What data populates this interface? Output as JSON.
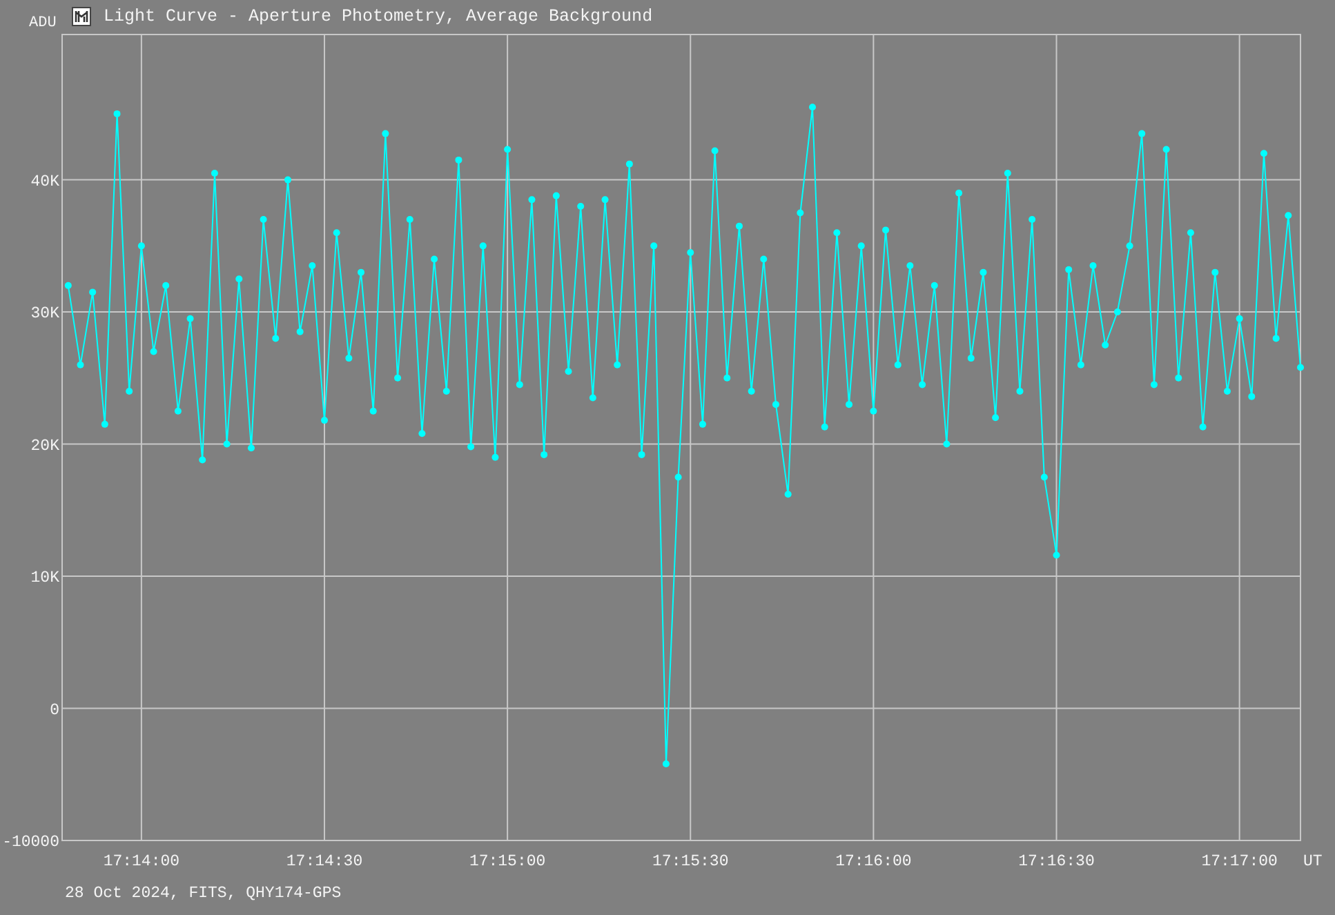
{
  "window": {
    "title": "Light Curve - Aperture Photometry, Average Background"
  },
  "chart": {
    "chart_data": {
      "type": "line",
      "ylabel": "ADU",
      "xlabel": "UT",
      "categories": [
        null,
        null,
        null,
        null,
        null,
        null,
        "17:14:00",
        null,
        null,
        null,
        null,
        null,
        null,
        null,
        null,
        null,
        null,
        null,
        null,
        null,
        null,
        "17:14:30",
        null,
        null,
        null,
        null,
        null,
        null,
        null,
        null,
        null,
        null,
        null,
        null,
        null,
        null,
        "17:15:00",
        null,
        null,
        null,
        null,
        null,
        null,
        null,
        null,
        null,
        null,
        null,
        null,
        null,
        null,
        "17:15:30",
        null,
        null,
        null,
        null,
        null,
        null,
        null,
        null,
        null,
        null,
        null,
        null,
        null,
        null,
        "17:16:00",
        null,
        null,
        null,
        null,
        null,
        null,
        null,
        null,
        null,
        null,
        null,
        null,
        null,
        null,
        "17:16:30",
        null,
        null,
        null,
        null,
        null,
        null,
        null,
        null,
        null,
        null,
        null,
        null,
        null,
        null,
        "17:17:00",
        null,
        null,
        null,
        null,
        null
      ],
      "grid": true,
      "series": [
        {
          "color": "#00ffff",
          "marker": "circle",
          "values": [
            32000,
            26000,
            31500,
            21500,
            45000,
            24000,
            35000,
            27000,
            32000,
            22500,
            29500,
            18800,
            40500,
            20000,
            32500,
            19700,
            37000,
            28000,
            40000,
            28500,
            33500,
            21800,
            36000,
            26500,
            33000,
            22500,
            43500,
            25000,
            37000,
            20800,
            34000,
            24000,
            41500,
            19800,
            35000,
            19000,
            42300,
            24500,
            38500,
            19200,
            38800,
            25500,
            38000,
            23500,
            38500,
            26000,
            41200,
            19200,
            35000,
            -4200,
            17500,
            34500,
            21500,
            42200,
            25000,
            36500,
            24000,
            34000,
            23000,
            16200,
            37500,
            45500,
            21300,
            36000,
            23000,
            35000,
            22500,
            36200,
            26000,
            33500,
            24500,
            32000,
            20000,
            39000,
            26500,
            33000,
            22000,
            40500,
            24000,
            37000,
            17500,
            11600,
            33200,
            26000,
            33500,
            27500,
            30000,
            35000,
            43500,
            24500,
            42300,
            25000,
            36000,
            21300,
            33000,
            24000,
            29500,
            23600,
            42000,
            28000,
            37300,
            25800
          ]
        }
      ],
      "ylim": [
        -10000,
        51000
      ],
      "yticks": [
        {
          "value": -10000,
          "label": "-10000"
        },
        {
          "value": 0,
          "label": "0"
        },
        {
          "value": 10000,
          "label": "10K"
        },
        {
          "value": 20000,
          "label": "20K"
        },
        {
          "value": 30000,
          "label": "30K"
        },
        {
          "value": 40000,
          "label": "40K"
        }
      ]
    }
  },
  "footer": "28 Oct 2024, FITS, QHY174-GPS"
}
